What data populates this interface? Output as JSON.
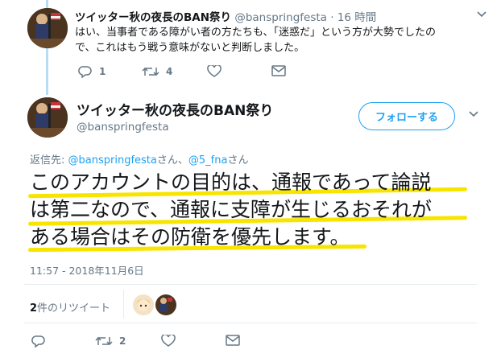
{
  "reply": {
    "display_name": "ツイッター秋の夜長のBAN祭り",
    "handle": "@banspringfesta",
    "separator": "·",
    "time": "16 時間",
    "text_line1": "はい、当事者である障がい者の方たちも、「迷惑だ」という方が大勢でしたの",
    "text_line2": "で、これはもう戦う意味がないと判断しました。",
    "reply_count": "1",
    "retweet_count": "4",
    "like_count": "",
    "icons": [
      "reply-icon",
      "retweet-icon",
      "like-icon",
      "dm-icon",
      "chevron-down-icon"
    ]
  },
  "main": {
    "display_name": "ツイッター秋の夜長のBAN祭り",
    "handle": "@banspringfesta",
    "follow_label": "フォローする",
    "reply_to_prefix": "返信先: ",
    "reply_to_user1": "@banspringfesta",
    "reply_to_mid": "さん、",
    "reply_to_user2": "@5_fna",
    "reply_to_suffix": "さん",
    "text_line1": "このアカウントの目的は、通報であって論説",
    "text_line2": "は第二なので、通報に支障が生じるおそれが",
    "text_line3": "ある場合はその防衛を優先します。",
    "timestamp": "11:57 - 2018年11月6日",
    "retweets_count": "2",
    "retweets_label": "件のリツイート",
    "reply_count": "",
    "retweet_count": "2",
    "like_count": "",
    "highlight_color": "#f7e500",
    "accent_color": "#1da1f2"
  }
}
